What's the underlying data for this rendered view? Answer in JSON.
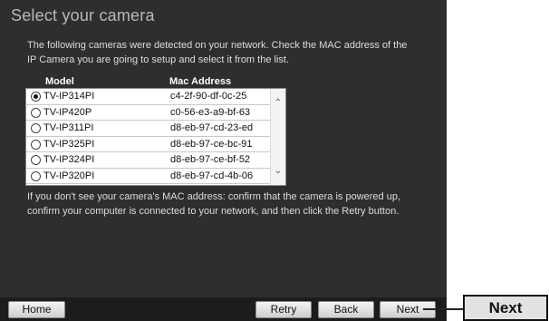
{
  "title": "Select your camera",
  "intro": "The following cameras were detected on your network. Check the MAC address of the IP Camera you are going to setup and select it from the list.",
  "table": {
    "columns": [
      "Model",
      "Mac Address"
    ],
    "rows": [
      {
        "model": "TV-IP314PI",
        "mac": "c4-2f-90-df-0c-25",
        "selected": true
      },
      {
        "model": "TV-IP420P",
        "mac": "c0-56-e3-a9-bf-63",
        "selected": false
      },
      {
        "model": "TV-IP311PI",
        "mac": "d8-eb-97-cd-23-ed",
        "selected": false
      },
      {
        "model": "TV-IP325PI",
        "mac": "d8-eb-97-ce-bc-91",
        "selected": false
      },
      {
        "model": "TV-IP324PI",
        "mac": "d8-eb-97-ce-bf-52",
        "selected": false
      },
      {
        "model": "TV-IP320PI",
        "mac": "d8-eb-97-cd-4b-06",
        "selected": false
      }
    ]
  },
  "help": "If you don't see your camera's MAC address: confirm that the camera is powered up, confirm your computer is connected to your network, and then click the Retry button.",
  "buttons": {
    "home": "Home",
    "retry": "Retry",
    "back": "Back",
    "next": "Next"
  },
  "callout": "Next",
  "icons": {
    "scroll_up": "chevron-up-icon",
    "scroll_down": "chevron-down-icon",
    "radio": "radio-button"
  }
}
